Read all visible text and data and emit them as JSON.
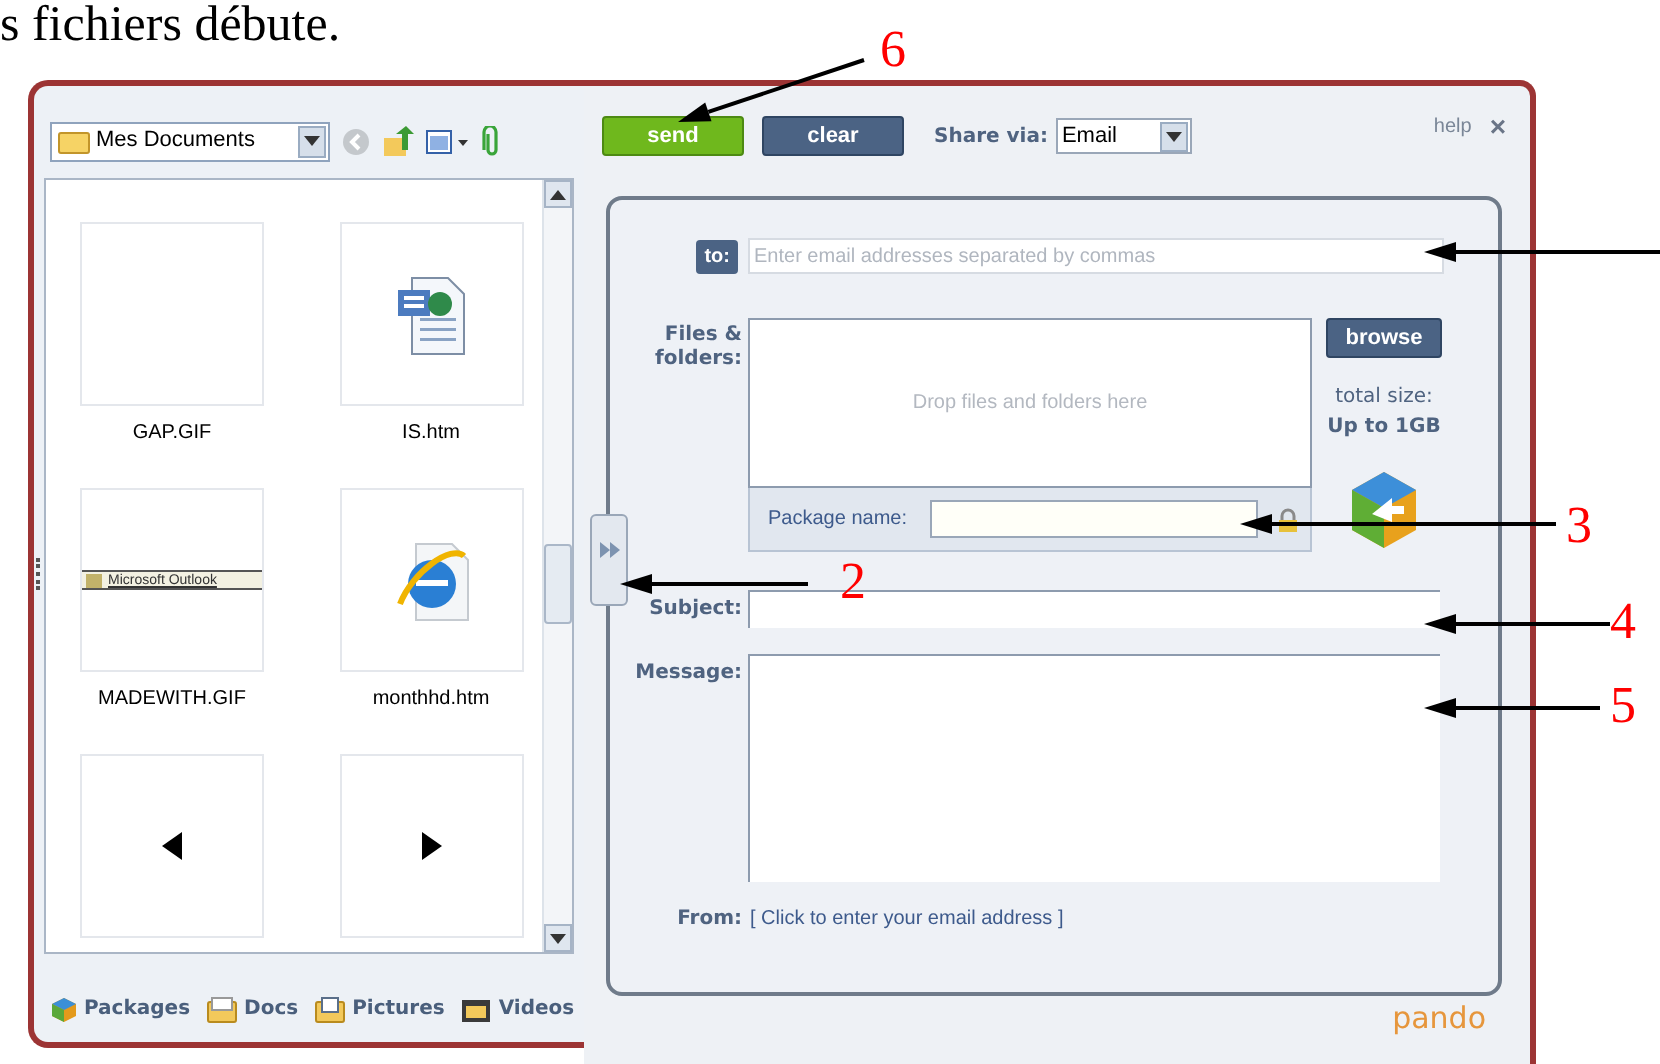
{
  "document_text": "s fichiers débute.",
  "file_browser": {
    "location": "Mes Documents",
    "files": [
      {
        "name": "GAP.GIF",
        "kind": "blank"
      },
      {
        "name": "IS.htm",
        "kind": "document"
      },
      {
        "name": "MADEWITH.GIF",
        "kind": "banner",
        "thumbnail_text": "Microsoft Outlook"
      },
      {
        "name": "monthhd.htm",
        "kind": "browser"
      },
      {
        "kind": "previous"
      },
      {
        "kind": "next"
      }
    ],
    "tabs": [
      "Packages",
      "Docs",
      "Pictures",
      "Videos"
    ]
  },
  "share_panel": {
    "send": "send",
    "clear": "clear",
    "share_via_label": "Share via:",
    "share_via": "Email",
    "help": "help",
    "close": "×",
    "to_label": "to:",
    "to_placeholder": "Enter email addresses separated by commas",
    "files_label": "Files & folders:",
    "drop_hint": "Drop files and folders here",
    "browse": "browse",
    "total_size_label": "total size:",
    "total_size": "Up to 1GB",
    "package_name_label": "Package name:",
    "subject_label": "Subject:",
    "message_label": "Message:",
    "from_label": "From:",
    "from_link": "[ Click to enter your email address ]",
    "brand": "pando"
  },
  "annotations": [
    "6",
    "2",
    "3",
    "4",
    "5"
  ]
}
